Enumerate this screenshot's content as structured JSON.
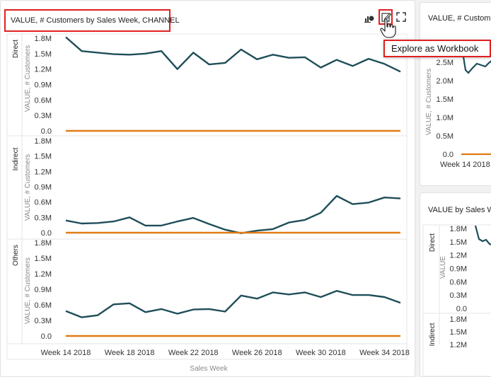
{
  "main_card": {
    "title": "VALUE, # Customers by Sales Week, CHANNEL",
    "toolbar": [
      "chart-settings-icon",
      "explore-as-workbook-icon",
      "maximize-icon"
    ]
  },
  "tooltip": {
    "text": "Explore as Workbook"
  },
  "top_right_card": {
    "title": "VALUE, # Customers"
  },
  "bottom_right_card": {
    "title": "VALUE by Sales Week"
  },
  "colors": {
    "series_1": "#1f4e59",
    "series_2": "#e07b16",
    "highlight": "#e02020"
  },
  "chart_data": [
    {
      "type": "line",
      "x_axis_title": "Sales Week",
      "x_tick_labels": [
        "Week 14 2018",
        "Week 18 2018",
        "Week 22 2018",
        "Week 26 2018",
        "Week 30 2018",
        "Week 34 2018"
      ],
      "y_axis_title": "VALUE, # Customers",
      "y_tick_labels": [
        "1.8M",
        "1.5M",
        "1.2M",
        "0.9M",
        "0.6M",
        "0.3M",
        "0.0"
      ],
      "ylim": [
        0,
        1800000
      ],
      "x": [
        "Week 14 2018",
        "Week 15 2018",
        "Week 16 2018",
        "Week 17 2018",
        "Week 18 2018",
        "Week 19 2018",
        "Week 20 2018",
        "Week 21 2018",
        "Week 22 2018",
        "Week 23 2018",
        "Week 24 2018",
        "Week 25 2018",
        "Week 26 2018",
        "Week 27 2018",
        "Week 28 2018",
        "Week 29 2018",
        "Week 30 2018",
        "Week 31 2018",
        "Week 32 2018",
        "Week 33 2018",
        "Week 34 2018",
        "Week 35 2018"
      ],
      "panels": [
        {
          "label": "Direct",
          "series": [
            {
              "values": [
                1820000,
                1550000,
                1520000,
                1490000,
                1480000,
                1500000,
                1550000,
                1200000,
                1520000,
                1290000,
                1320000,
                1580000,
                1390000,
                1480000,
                1420000,
                1430000,
                1230000,
                1380000,
                1260000,
                1400000,
                1300000,
                1150000
              ]
            },
            {
              "values": [
                0,
                0,
                0,
                0,
                0,
                0,
                0,
                0,
                0,
                0,
                0,
                0,
                0,
                0,
                0,
                0,
                0,
                0,
                0,
                0,
                0,
                0
              ]
            }
          ]
        },
        {
          "label": "Indirect",
          "series": [
            {
              "values": [
                240000,
                180000,
                190000,
                220000,
                300000,
                140000,
                140000,
                220000,
                290000,
                170000,
                60000,
                -10000,
                40000,
                70000,
                200000,
                250000,
                390000,
                720000,
                560000,
                590000,
                690000,
                670000
              ]
            },
            {
              "values": [
                0,
                0,
                0,
                0,
                0,
                0,
                0,
                0,
                0,
                0,
                0,
                0,
                0,
                0,
                0,
                0,
                0,
                0,
                0,
                0,
                0,
                0
              ]
            }
          ]
        },
        {
          "label": "Others",
          "series": [
            {
              "values": [
                480000,
                360000,
                400000,
                610000,
                630000,
                460000,
                520000,
                430000,
                510000,
                520000,
                470000,
                780000,
                720000,
                840000,
                800000,
                840000,
                750000,
                870000,
                790000,
                790000,
                750000,
                640000
              ]
            },
            {
              "values": [
                0,
                0,
                0,
                0,
                0,
                0,
                0,
                0,
                0,
                0,
                0,
                0,
                0,
                0,
                0,
                0,
                0,
                0,
                0,
                0,
                0,
                0
              ]
            }
          ]
        }
      ]
    },
    {
      "type": "line",
      "x_tick_labels": [
        "Week 14 2018"
      ],
      "y_axis_title": "VALUE, # Customers",
      "y_tick_labels": [
        "2.5M",
        "2.0M",
        "1.5M",
        "1.0M",
        "0.5M",
        "0.0"
      ],
      "ylim": [
        0,
        2500000
      ]
    },
    {
      "type": "line",
      "y_axis_title": "VALUE",
      "row_labels": [
        "Direct",
        "Indirect"
      ],
      "panel_1_y_tick_labels": [
        "1.8M",
        "1.5M",
        "1.2M",
        "0.9M",
        "0.6M",
        "0.3M",
        "0.0"
      ],
      "panel_2_y_tick_labels": [
        "1.8M",
        "1.5M",
        "1.2M"
      ],
      "ylim": [
        0,
        1800000
      ]
    }
  ]
}
